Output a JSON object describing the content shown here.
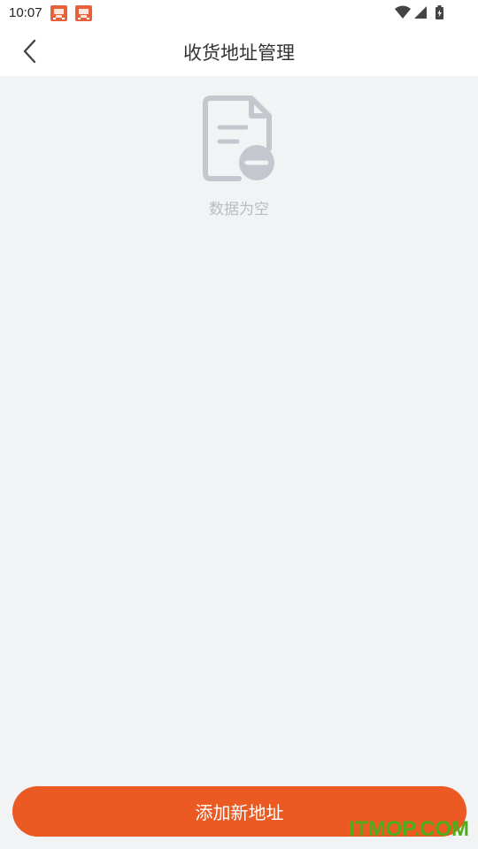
{
  "status_bar": {
    "time": "10:07",
    "icons": [
      "notification-app-icon",
      "notification-app-icon",
      "wifi-icon",
      "signal-icon",
      "battery-charging-icon"
    ]
  },
  "header": {
    "title": "收货地址管理",
    "back_icon": "chevron-left-icon"
  },
  "empty_state": {
    "icon": "empty-document-icon",
    "text": "数据为空"
  },
  "footer": {
    "add_button_label": "添加新地址"
  },
  "watermark": {
    "text": "ITMOP.COM"
  },
  "colors": {
    "accent": "#ec5a24",
    "background": "#f2f3f5",
    "empty_icon": "#c4c7ce",
    "empty_text": "#b9bcc2",
    "watermark": "#4caf1a"
  }
}
